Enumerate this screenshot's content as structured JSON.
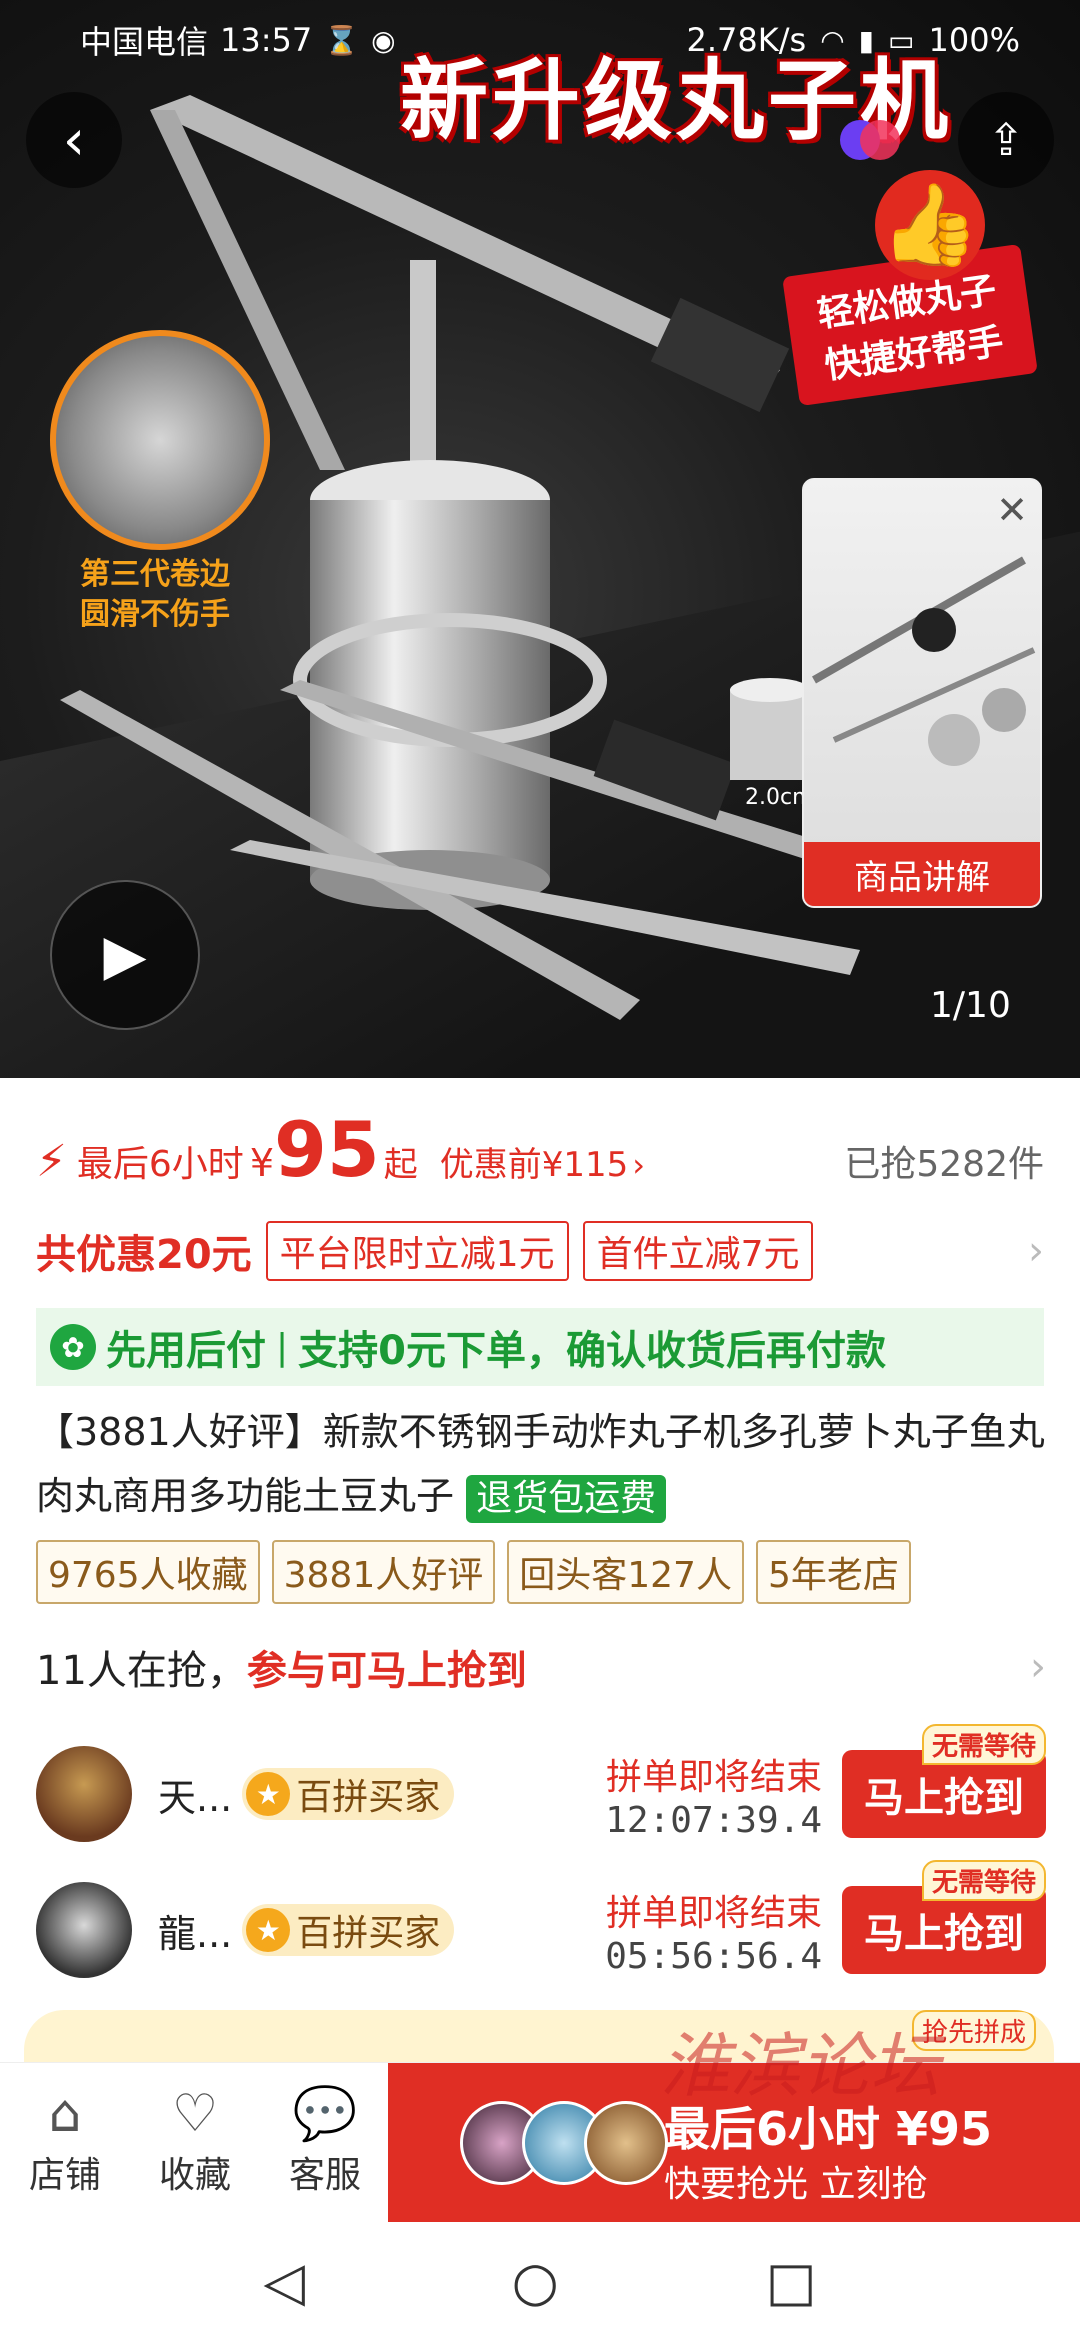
{
  "status_bar": {
    "carrier": "中国电信",
    "time": "13:57",
    "network_speed": "2.78K/s",
    "battery": "100%"
  },
  "hero": {
    "promo_title": "新升级丸子机",
    "badge_line1": "轻松做丸子",
    "badge_line2": "快捷好帮手",
    "zoom_caption_line1": "第三代卷边",
    "zoom_caption_line2": "圆滑不伤手",
    "size_label": "2.0cm",
    "mini_video_label": "商品讲解",
    "page_counter": "1/10"
  },
  "price": {
    "prefix": "最后6小时",
    "currency": "¥",
    "value": "95",
    "suffix": "起",
    "original": "优惠前¥115",
    "sold": "已抢5282件"
  },
  "discount": {
    "total": "共优惠20元",
    "coupons": [
      "平台限时立减1元",
      "首件立减7元"
    ]
  },
  "pay_later": {
    "title": "先用后付",
    "desc": "支持0元下单，确认收货后再付款"
  },
  "product": {
    "title": "【3881人好评】新款不锈钢手动炸丸子机多孔萝卜丸子鱼丸肉丸商用多功能土豆丸子",
    "return_tag": "退货包运费",
    "tags": [
      "9765人收藏",
      "3881人好评",
      "回头客127人",
      "5年老店"
    ]
  },
  "group_buy": {
    "count_text": "11人在抢，",
    "highlight": "参与可马上抢到",
    "rows": [
      {
        "name": "天...",
        "badge": "百拼买家",
        "status": "拼单即将结束",
        "countdown": "12:07:39.4",
        "button": "马上抢到",
        "button_tag": "无需等待"
      },
      {
        "name": "龍...",
        "badge": "百拼买家",
        "status": "拼单即将结束",
        "countdown": "05:56:56.4",
        "button": "马上抢到",
        "button_tag": "无需等待"
      }
    ],
    "third_tag": "抢先拼成"
  },
  "bottom_bar": {
    "store": "店铺",
    "favorite": "收藏",
    "service": "客服",
    "buy_line1": "最后6小时 ¥95",
    "buy_line2": "快要抢光 立刻抢"
  },
  "watermark": "淮滨论坛"
}
